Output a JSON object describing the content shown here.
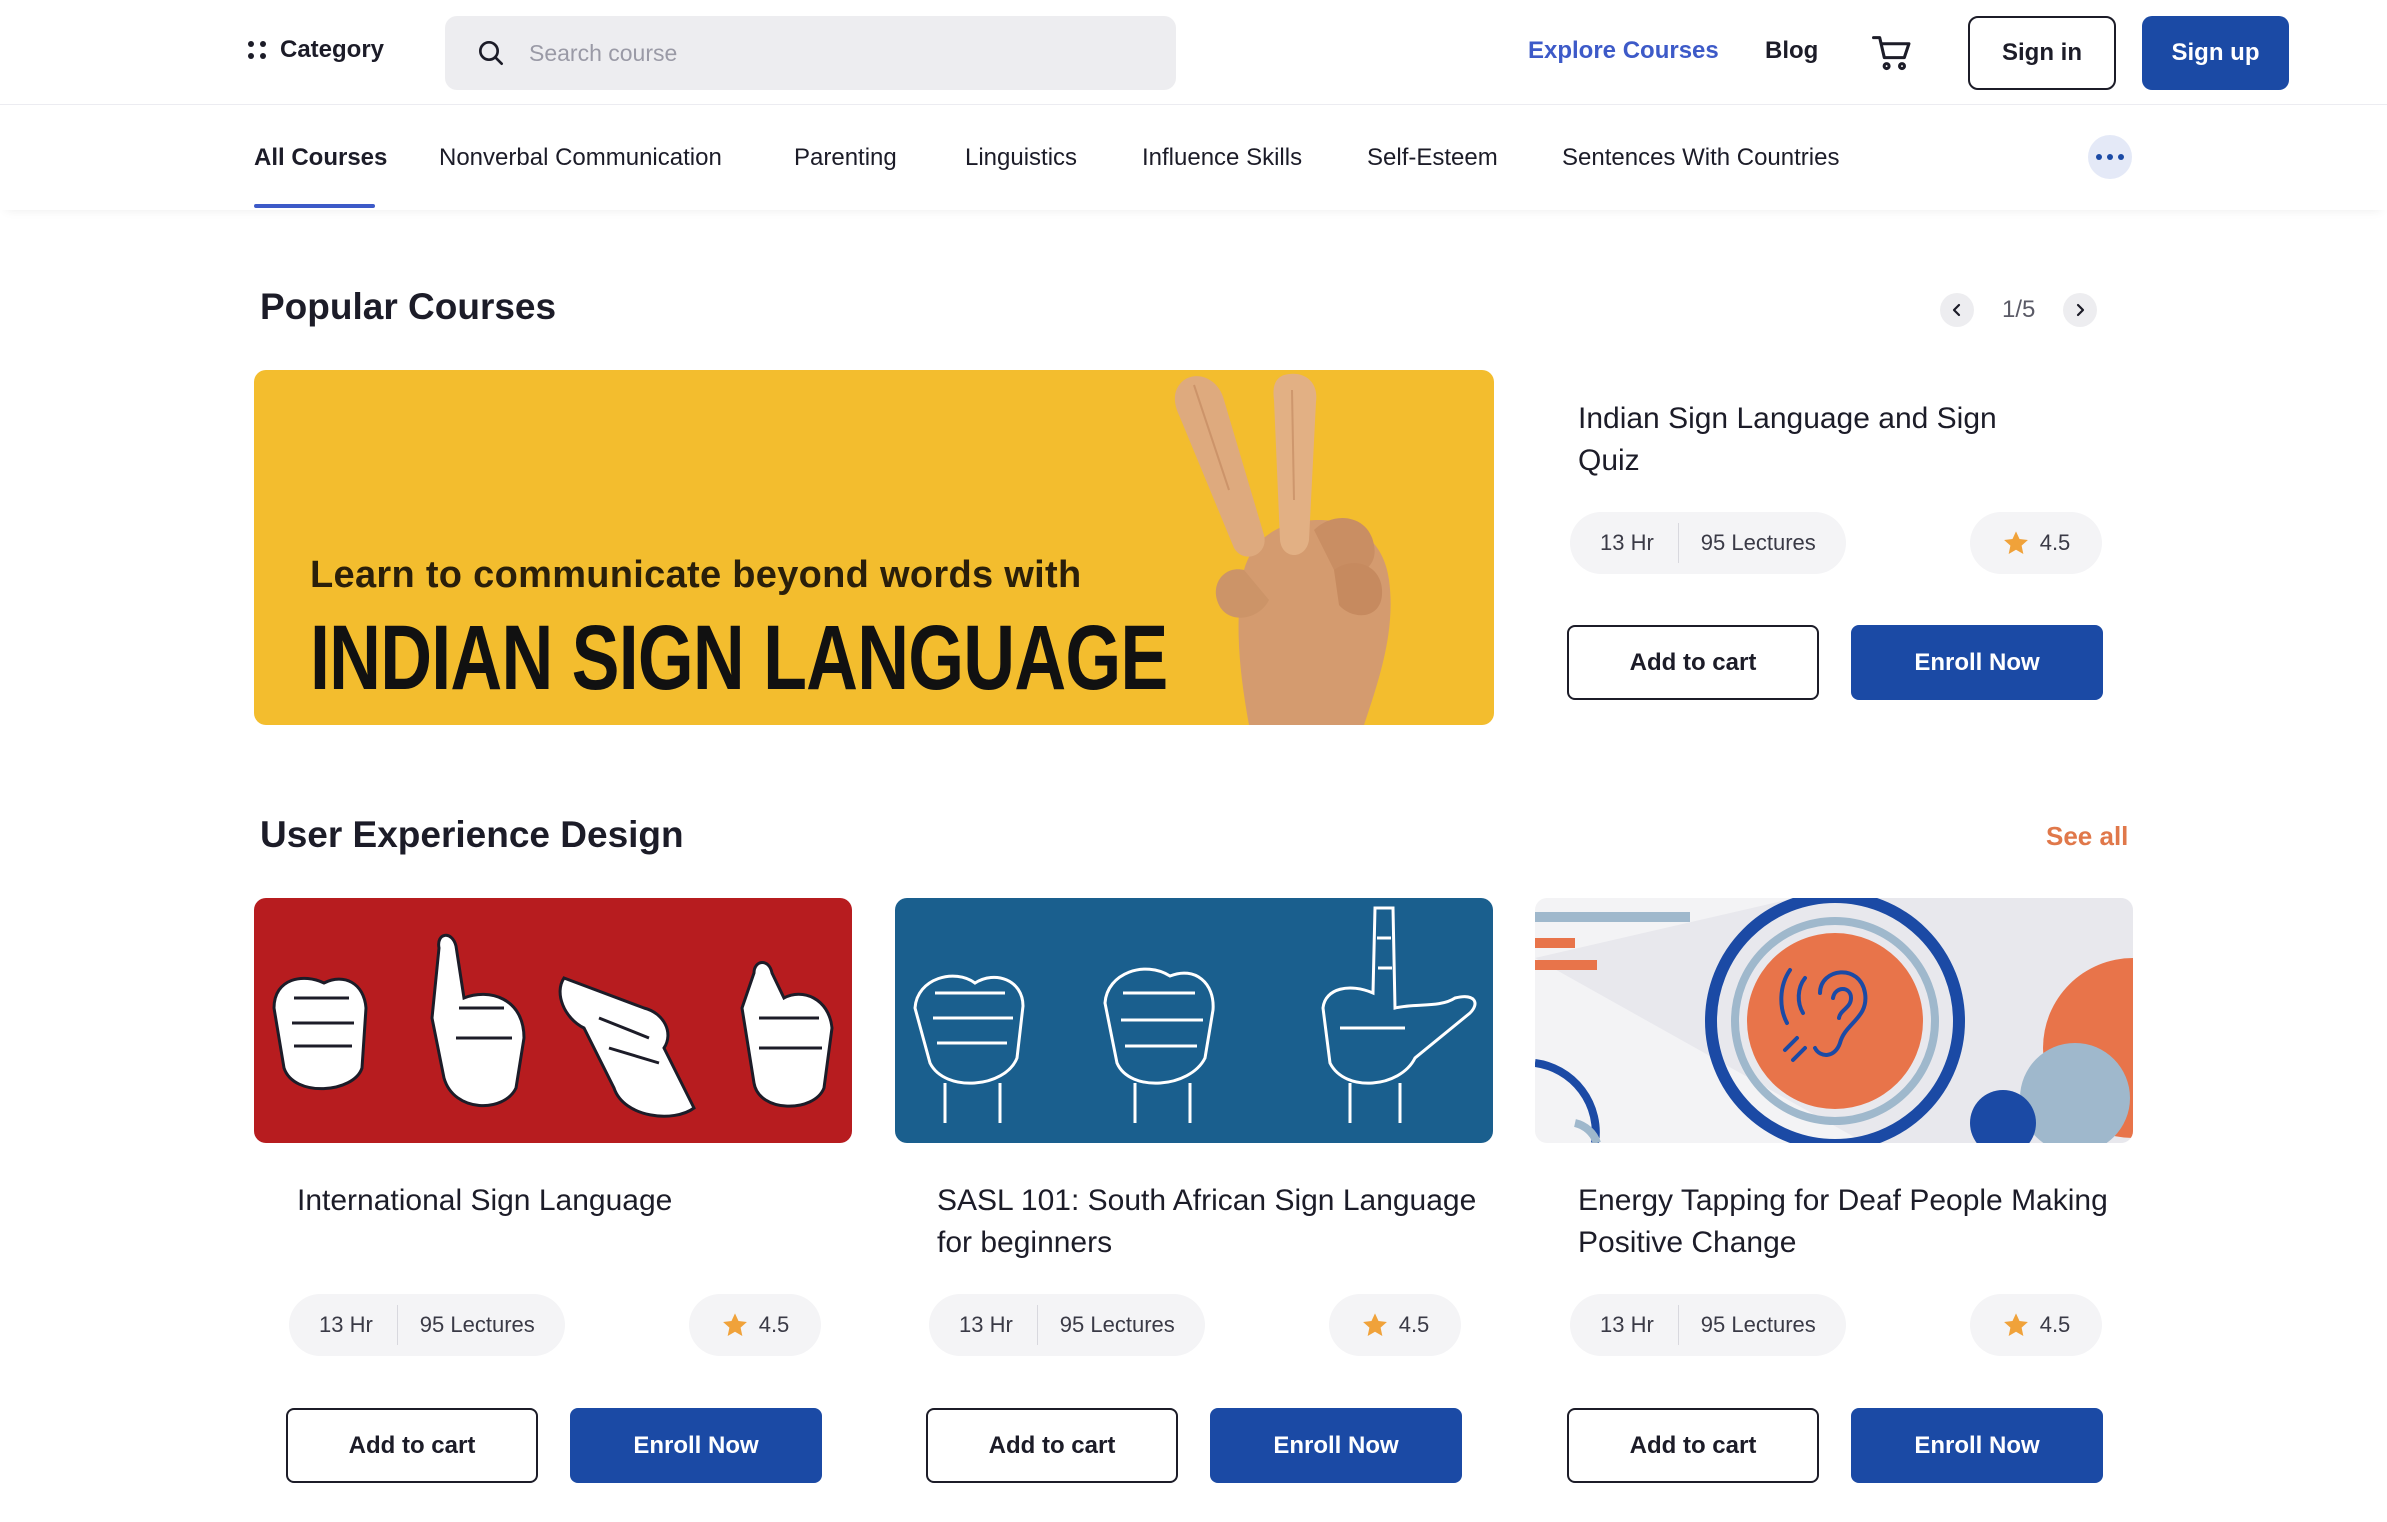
{
  "header": {
    "category_label": "Category",
    "search_placeholder": "Search course",
    "explore_label": "Explore Courses",
    "blog_label": "Blog",
    "signin_label": "Sign in",
    "signup_label": "Sign up"
  },
  "tabs": [
    {
      "label": "All Courses",
      "active": true
    },
    {
      "label": "Nonverbal Communication"
    },
    {
      "label": "Parenting"
    },
    {
      "label": "Linguistics"
    },
    {
      "label": "Influence Skills"
    },
    {
      "label": "Self-Esteem"
    },
    {
      "label": "Sentences With Countries"
    }
  ],
  "popular": {
    "section_title": "Popular Courses",
    "pager": "1/5",
    "banner": {
      "line1": "Learn to communicate beyond words with",
      "line2": "INDIAN SIGN LANGUAGE"
    },
    "course": {
      "title": "Indian Sign Language and Sign Quiz",
      "hours": "13 Hr",
      "lectures": "95 Lectures",
      "rating": "4.5",
      "add_to_cart": "Add to cart",
      "enroll": "Enroll Now"
    }
  },
  "ux_section": {
    "section_title": "User Experience Design",
    "see_all": "See all",
    "courses": [
      {
        "title": "International Sign Language",
        "hours": "13 Hr",
        "lectures": "95 Lectures",
        "rating": "4.5",
        "add_to_cart": "Add to cart",
        "enroll": "Enroll Now"
      },
      {
        "title": "SASL 101: South African Sign Language for beginners",
        "hours": "13 Hr",
        "lectures": "95 Lectures",
        "rating": "4.5",
        "add_to_cart": "Add to cart",
        "enroll": "Enroll Now"
      },
      {
        "title": "Energy Tapping for Deaf People Making Positive Change",
        "hours": "13 Hr",
        "lectures": "95 Lectures",
        "rating": "4.5",
        "add_to_cart": "Add to cart",
        "enroll": "Enroll Now"
      }
    ]
  },
  "colors": {
    "primary": "#1b4aa5",
    "accent_link": "#3d5ac8",
    "see_all": "#e0784a",
    "banner_yellow": "#f3bd2e",
    "card_red": "#b71c1f",
    "card_blue": "#1a5f8e",
    "star": "#f0a23a"
  }
}
